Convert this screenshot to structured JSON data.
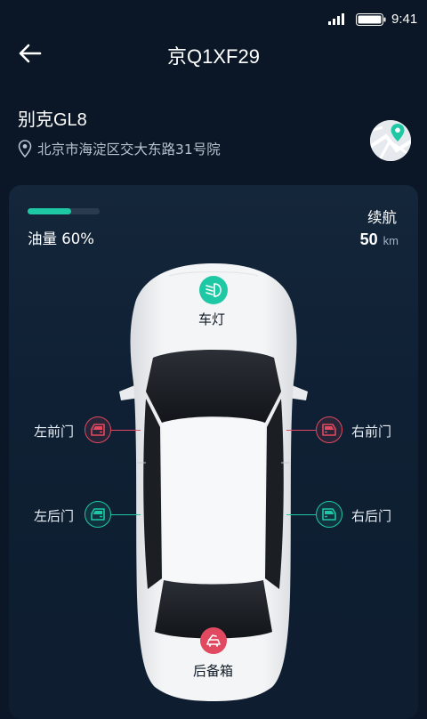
{
  "status_bar": {
    "time": "9:41"
  },
  "header": {
    "title": "京Q1XF29"
  },
  "vehicle": {
    "model": "别克GL8",
    "address": "北京市海淀区交大东路31号院"
  },
  "fuel": {
    "label": "油量 60%",
    "level": 0.6
  },
  "range": {
    "label": "续航",
    "value": "50",
    "unit": "km"
  },
  "controls": {
    "lights": {
      "label": "车灯",
      "state": "on"
    },
    "front_left": {
      "label": "左前门",
      "state": "open"
    },
    "front_right": {
      "label": "右前门",
      "state": "open"
    },
    "rear_left": {
      "label": "左后门",
      "state": "closed"
    },
    "rear_right": {
      "label": "右后门",
      "state": "closed"
    },
    "trunk": {
      "label": "后备箱",
      "state": "open"
    }
  },
  "colors": {
    "accent_green": "#1ec8a5",
    "alert_red": "#e0495f",
    "background": "#0b1726"
  }
}
